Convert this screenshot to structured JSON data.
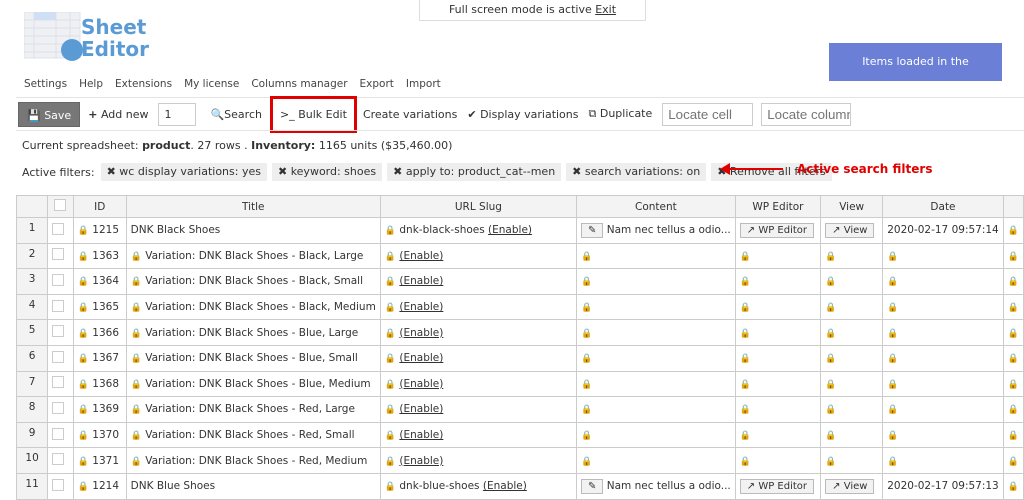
{
  "fullscreen": {
    "text": "Full screen mode is active",
    "exit": "Exit"
  },
  "logo": {
    "line1": "Sheet",
    "line2": "Editor"
  },
  "loaded_label": "Items loaded in the spreadsheet",
  "menu": [
    "Settings",
    "Help",
    "Extensions",
    "My license",
    "Columns manager",
    "Export",
    "Import"
  ],
  "toolbar": {
    "save": "Save",
    "add_new": "Add new",
    "add_count": "1",
    "search": "Search",
    "bulk_edit": "Bulk Edit",
    "create_variations": "Create variations",
    "display_variations": "Display variations",
    "duplicate": "Duplicate",
    "locate_cell_placeholder": "Locate cell",
    "locate_column_placeholder": "Locate column"
  },
  "info": {
    "prefix": "Current spreadsheet: ",
    "sheet": "product",
    "rows": ". 27 rows . ",
    "inv_label": "Inventory:",
    "inv_value": " 1165 units ($35,460.00)"
  },
  "filters": {
    "label": "Active filters:",
    "chips": [
      "wc display variations: yes",
      "keyword: shoes",
      "apply to: product_cat--men",
      "search variations: on"
    ],
    "remove_all": "Remove all filters"
  },
  "annotation": "Active search filters",
  "colors": {
    "accent": "#6b7fd7",
    "highlight": "#e00000",
    "save": "#777777"
  },
  "table": {
    "columns": [
      "ID",
      "Title",
      "URL Slug",
      "Content",
      "WP Editor",
      "View",
      "Date"
    ],
    "enable": "(Enable)",
    "wp_editor_btn": "WP Editor",
    "view_btn": "View",
    "rows": [
      {
        "n": "1",
        "id": "1215",
        "title": "DNK Black Shoes",
        "slug": "dnk-black-shoes",
        "content": "Nam nec tellus a odio...",
        "date": "2020-02-17 09:57:14",
        "parent": true
      },
      {
        "n": "2",
        "id": "1363",
        "title": "Variation: DNK Black Shoes - Black, Large"
      },
      {
        "n": "3",
        "id": "1364",
        "title": "Variation: DNK Black Shoes - Black, Small"
      },
      {
        "n": "4",
        "id": "1365",
        "title": "Variation: DNK Black Shoes - Black, Medium"
      },
      {
        "n": "5",
        "id": "1366",
        "title": "Variation: DNK Black Shoes - Blue, Large"
      },
      {
        "n": "6",
        "id": "1367",
        "title": "Variation: DNK Black Shoes - Blue, Small"
      },
      {
        "n": "7",
        "id": "1368",
        "title": "Variation: DNK Black Shoes - Blue, Medium"
      },
      {
        "n": "8",
        "id": "1369",
        "title": "Variation: DNK Black Shoes - Red, Large"
      },
      {
        "n": "9",
        "id": "1370",
        "title": "Variation: DNK Black Shoes - Red, Small"
      },
      {
        "n": "10",
        "id": "1371",
        "title": "Variation: DNK Black Shoes - Red, Medium"
      },
      {
        "n": "11",
        "id": "1214",
        "title": "DNK Blue Shoes",
        "slug": "dnk-blue-shoes",
        "content": "Nam nec tellus a odio...",
        "date": "2020-02-17 09:57:13",
        "parent": true
      }
    ]
  }
}
